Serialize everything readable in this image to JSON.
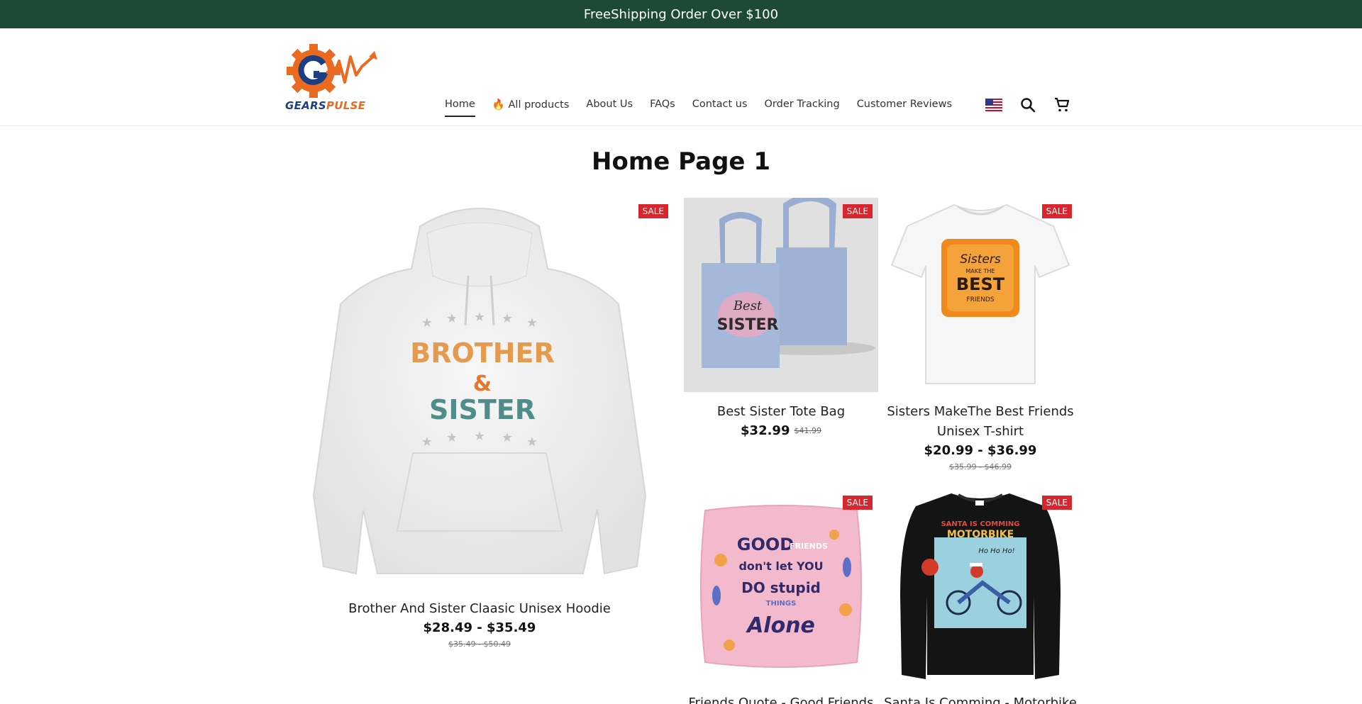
{
  "announcement": "FreeShipping Order Over $100",
  "brand": {
    "logo_text_1": "GEARS",
    "logo_text_2": "PULSE"
  },
  "nav": [
    {
      "label": "Home"
    },
    {
      "label": "🔥 All products"
    },
    {
      "label": "About Us"
    },
    {
      "label": "FAQs"
    },
    {
      "label": "Contact us"
    },
    {
      "label": "Order Tracking"
    },
    {
      "label": "Customer Reviews"
    }
  ],
  "header_icons": [
    "us-flag-icon",
    "search-icon",
    "cart-icon"
  ],
  "page_title": "Home Page 1",
  "sale_label": "SALE",
  "products": [
    {
      "title": "Brother And Sister Claasic Unisex Hoodie",
      "price": "$28.49 - $35.49",
      "old_price": "$35.49 - $50.49",
      "art": [
        "BROTHER",
        "&",
        "SISTER"
      ]
    },
    {
      "title": "Best Sister Tote Bag",
      "price": "$32.99",
      "old_price": "$41.99",
      "art": [
        "Best",
        "SISTER"
      ]
    },
    {
      "title": "Sisters MakeThe Best Friends Unisex T-shirt",
      "price": "$20.99 - $36.99",
      "old_price": "$35.99 - $46.99",
      "art": [
        "Sisters",
        "MAKE THE",
        "BEST",
        "FRIENDS"
      ]
    },
    {
      "title": "Friends Quote - Good Friends",
      "art": [
        "GOOD",
        "FRIENDS",
        "don't let YOU",
        "DO stupid",
        "THINGS",
        "Alone"
      ]
    },
    {
      "title": "Santa Is Comming - Motorbike",
      "art": [
        "SANTA IS COMMING",
        "MOTORBIKE",
        "Ho Ho Ho!"
      ]
    }
  ],
  "colors": {
    "announce_bg": "#1c4a37",
    "sale_bg": "#d7262e"
  }
}
